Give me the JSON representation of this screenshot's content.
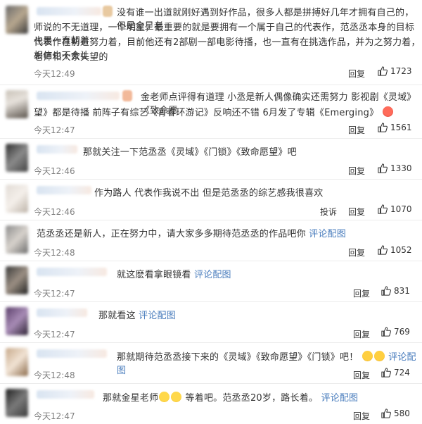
{
  "comments": [
    {
      "text_lines": [
        "没有谁一出道就刚好遇到好作品，很多人都是拼搏好几年才拥有自己的，但是金星老",
        "师说的不无道理，一个明星，最重要的就是要拥有一个属于自己的代表作，范丞丞本身的目标也是一直朝着",
        "代表作在前进努力着，目前他还有2部剧一部电影待播，也一直有在挑选作品，并为之努力着，相信也不会让",
        "老师和大家失望的"
      ],
      "time": "今天12:49",
      "reply": "回复",
      "likes": "1723"
    },
    {
      "text_lines": [
        "金老师点评得有道理 小丞是新人偶像确实还需努力 影视剧《灵域》《致命愿",
        "望》都是待播 前阵子有综艺《青春环游记》反响还不错 6月发了专辑《Emerging》"
      ],
      "time": "今天12:47",
      "reply": "回复",
      "likes": "1561"
    },
    {
      "text": "那就关注一下范丞丞《灵域》《门锁》《致命愿望》吧",
      "time": "今天12:46",
      "reply": "回复",
      "likes": "1330"
    },
    {
      "text": "作为路人 代表作我说不出 但是范丞丞的综艺感我很喜欢",
      "time": "今天12:46",
      "report": "投诉",
      "reply": "回复",
      "likes": "1070"
    },
    {
      "text": "范丞丞还是新人，正在努力中，请大家多多期待范丞丞的作品吧你",
      "link": "评论配图",
      "time": "今天12:48",
      "reply": "回复",
      "likes": "1052"
    },
    {
      "text": "就这麽看拿眼镜看",
      "link": "评论配图",
      "time": "今天12:47",
      "reply": "回复",
      "likes": "831"
    },
    {
      "text": "那就看这",
      "link": "评论配图",
      "time": "今天12:47",
      "reply": "回复",
      "likes": "769"
    },
    {
      "text": "那就期待范丞丞接下来的《灵域》《致命愿望》《门锁》吧！",
      "link": "评论配图",
      "time": "今天12:48",
      "reply": "回复",
      "likes": "724"
    },
    {
      "text_a": "那就金星老师",
      "text_b": "等着吧。范丞丞20岁，路长着。",
      "link": "评论配图",
      "time": "今天12:47",
      "reply": "回复",
      "likes": "580"
    }
  ],
  "icons": {
    "like": "thumbs-up-icon",
    "emoji": "emoji-icon"
  },
  "colors": {
    "link": "#4a7dbd",
    "time": "#808080",
    "text": "#333333"
  }
}
